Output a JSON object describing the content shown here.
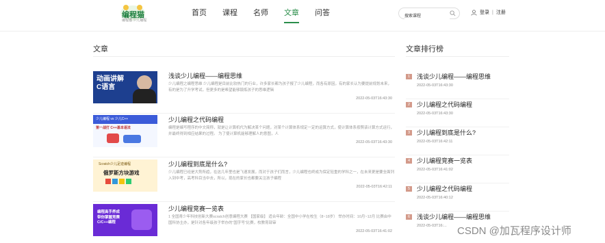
{
  "header": {
    "logo_text": "编程猫",
    "logo_sub": "编程猫 少儿编程",
    "nav": [
      "首页",
      "课程",
      "名师",
      "文章",
      "问答"
    ],
    "active_nav": "文章",
    "search_placeholder": "搜索课程",
    "login": "登录",
    "register": "注册"
  },
  "main": {
    "title": "文章",
    "articles": [
      {
        "title": "浅谈少儿编程——编程思维",
        "desc": "少儿编程之编程思维 少儿编程是目前比较热门的行业，许多家长都为孩子报了少儿编程，而各有原因，有的家长认为要提前规划未来，有的是为了升学考试，但更多的是希望能够锻炼孩子的思维逻辑",
        "time": "2022-05-03T16:43:30",
        "thumb": {
          "bg": "#1d3f8f",
          "title": "动画讲解",
          "sub": "C语言"
        }
      },
      {
        "title": "少儿编程之代码编程",
        "desc": "编程是编写程序的中文简称，就是让计算机代为解决某个问题，对某个计算体系规定一定的运算方式，使计算体系按照该计算方式运行，并最终得到相应结果的过程。 为了使计算机能够理解人的意图，人",
        "time": "2022-05-03T16:43:30",
        "thumb": {
          "bg": "#f4f7ff",
          "title": "少儿编程 vs 少儿C++",
          "sub": "第一战打 C++基本语法"
        }
      },
      {
        "title": "少儿编程到底是什么?",
        "desc": "少儿编程已经是大势所趋，在这几年里也是飞速发展，而对于孩子们而言，少儿编程也终成为保定轻重的学科之一，在未来更是要全面列入到中考，高考科目当中去，所以，现在的家长也都要关注孩子编程",
        "time": "2022-05-03T16:42:11",
        "thumb": {
          "bg": "#fff3d4",
          "title": "Scratch少儿足迹编程",
          "sub": "俄罗斯方块游戏"
        }
      },
      {
        "title": "少儿编程竞赛一览表",
        "desc": "1 全国青少年科技创新大赛scratch创意编程大赛 【国家级】 适合年龄：全国中小学在校生（8~18岁） 举办时间：10月~12月 比赛由中国科协主办，是针对各年级孩子举办的“国字号”比赛，校教育部审",
        "time": "2022-05-03T16:41:02",
        "thumb": {
          "bg": "#6a2bd6",
          "title": "编程高手养成",
          "sub": "带你掌握竞赛C/C++编程"
        }
      }
    ]
  },
  "side": {
    "title": "文章排行榜",
    "items": [
      {
        "num": "1",
        "title": "浅谈少儿编程——编程思维",
        "time": "2022-05-03T16:43:30"
      },
      {
        "num": "2",
        "title": "少儿编程之代码编程",
        "time": "2022-05-03T16:43:30"
      },
      {
        "num": "3",
        "title": "少儿编程到底是什么?",
        "time": "2022-05-03T16:42:11"
      },
      {
        "num": "4",
        "title": "少儿编程竞赛一览表",
        "time": "2022-05-03T16:41:02"
      },
      {
        "num": "5",
        "title": "少儿编程之代码编程",
        "time": "2022-05-03T16:40:12"
      },
      {
        "num": "6",
        "title": "浅谈少儿编程——编程思维",
        "time": "2022-05-03T16:..."
      }
    ]
  },
  "watermark": "CSDN @加瓦程序设计师",
  "colors": {
    "accent": "#2a8d4a",
    "rank_badge": "#d39a8a"
  }
}
